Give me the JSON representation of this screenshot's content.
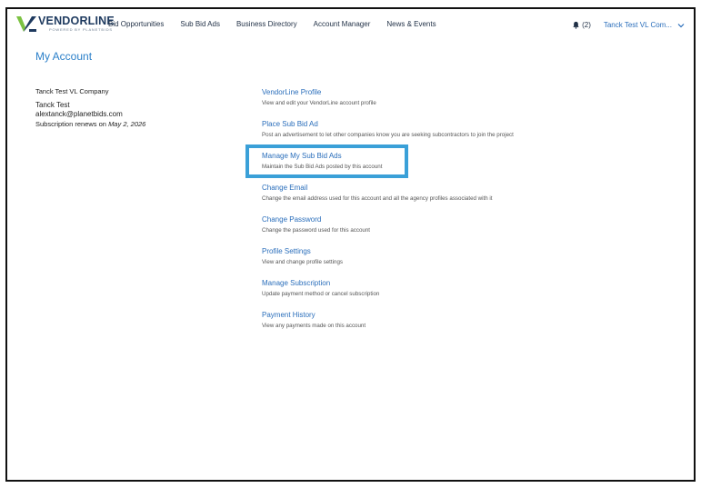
{
  "header": {
    "logo_text": "VENDORLINE",
    "logo_tagline": "POWERED BY PLANETBIDS",
    "nav": [
      "Bid Opportunities",
      "Sub Bid Ads",
      "Business Directory",
      "Account Manager",
      "News & Events"
    ],
    "notifications_label": "(2)",
    "account_label": "Tanck Test VL Com...",
    "colors": {
      "brand_blue": "#1e3a5f",
      "brand_green": "#7cc242",
      "link_blue": "#2a6ebb"
    }
  },
  "page": {
    "title": "My Account"
  },
  "account": {
    "company": "Tanck Test VL Company",
    "name": "Tanck Test",
    "email": "alextanck@planetbids.com",
    "renew_prefix": "Subscription renews on",
    "renew_date": "May 2, 2026"
  },
  "links": [
    {
      "title": "VendorLine Profile",
      "desc": "View and edit your VendorLine account profile"
    },
    {
      "title": "Place Sub Bid Ad",
      "desc": "Post an advertisement to let other companies know you are seeking subcontractors to join the project"
    },
    {
      "title": "Manage My Sub Bid Ads",
      "desc": "Maintain the Sub Bid Ads posted by this account"
    },
    {
      "title": "Change Email",
      "desc": "Change the email address used for this account and all the agency profiles associated with it"
    },
    {
      "title": "Change Password",
      "desc": "Change the password used for this account"
    },
    {
      "title": "Profile Settings",
      "desc": "View and change profile settings"
    },
    {
      "title": "Manage Subscription",
      "desc": "Update payment method or cancel subscription"
    },
    {
      "title": "Payment History",
      "desc": "View any payments made on this account"
    }
  ],
  "highlight_color": "#3aa0d8"
}
